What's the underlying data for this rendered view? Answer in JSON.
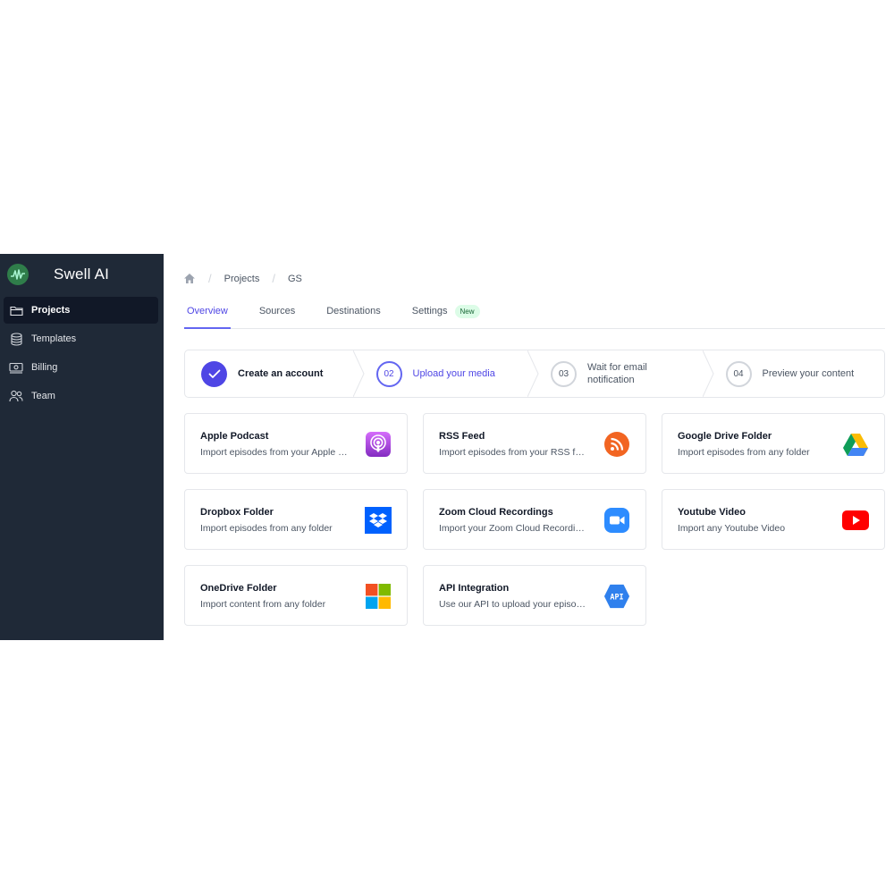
{
  "app": {
    "name": "Swell AI"
  },
  "sidebar": {
    "items": [
      {
        "label": "Projects",
        "icon": "folder-icon",
        "active": true
      },
      {
        "label": "Templates",
        "icon": "database-icon",
        "active": false
      },
      {
        "label": "Billing",
        "icon": "billing-icon",
        "active": false
      },
      {
        "label": "Team",
        "icon": "team-icon",
        "active": false
      }
    ]
  },
  "breadcrumb": {
    "home_icon": "home-icon",
    "items": [
      "Projects",
      "GS"
    ]
  },
  "tabs": {
    "items": [
      {
        "label": "Overview",
        "active": true
      },
      {
        "label": "Sources"
      },
      {
        "label": "Destinations"
      },
      {
        "label": "Settings",
        "badge": "New"
      }
    ]
  },
  "steps": [
    {
      "number": "",
      "label": "Create an account",
      "status": "done"
    },
    {
      "number": "02",
      "label": "Upload your media",
      "status": "current"
    },
    {
      "number": "03",
      "label": "Wait for email notification",
      "status": "todo"
    },
    {
      "number": "04",
      "label": "Preview your content",
      "status": "todo"
    }
  ],
  "sources": [
    {
      "title": "Apple Podcast",
      "description": "Import episodes from your Apple Podcast",
      "icon": "apple-podcast-icon"
    },
    {
      "title": "RSS Feed",
      "description": "Import episodes from your RSS feed",
      "icon": "rss-icon"
    },
    {
      "title": "Google Drive Folder",
      "description": "Import episodes from any folder",
      "icon": "google-drive-icon"
    },
    {
      "title": "Dropbox Folder",
      "description": "Import episodes from any folder",
      "icon": "dropbox-icon"
    },
    {
      "title": "Zoom Cloud Recordings",
      "description": "Import your Zoom Cloud Recordings",
      "icon": "zoom-icon"
    },
    {
      "title": "Youtube Video",
      "description": "Import any Youtube Video",
      "icon": "youtube-icon"
    },
    {
      "title": "OneDrive Folder",
      "description": "Import content from any folder",
      "icon": "onedrive-icon"
    },
    {
      "title": "API Integration",
      "description": "Use our API to upload your episodes",
      "icon": "api-icon",
      "icon_text": "API"
    }
  ],
  "colors": {
    "sidebar": "#1f2937",
    "accent": "#4f46e5",
    "badge_bg": "#dcfce7",
    "badge_text": "#166534"
  }
}
